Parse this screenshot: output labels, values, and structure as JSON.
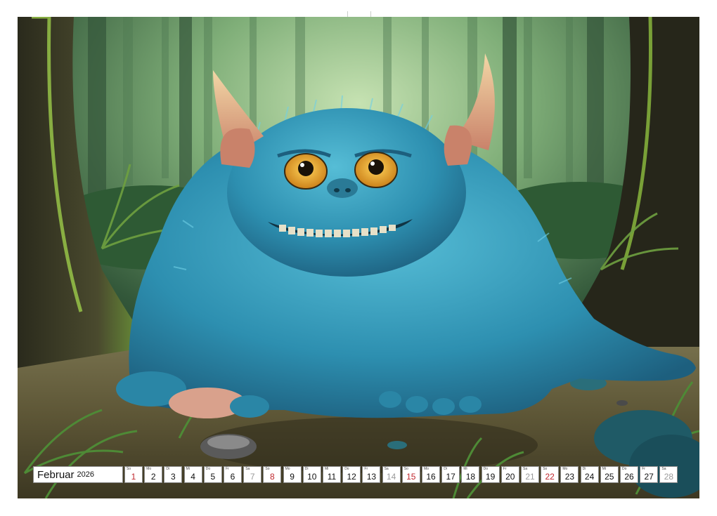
{
  "calendar": {
    "month": "Februar",
    "year": "2026",
    "days": [
      {
        "wd": "So",
        "num": "1",
        "type": "sun"
      },
      {
        "wd": "Mo",
        "num": "2",
        "type": "week"
      },
      {
        "wd": "Di",
        "num": "3",
        "type": "week"
      },
      {
        "wd": "Mi",
        "num": "4",
        "type": "week"
      },
      {
        "wd": "Do",
        "num": "5",
        "type": "week"
      },
      {
        "wd": "Fr",
        "num": "6",
        "type": "week"
      },
      {
        "wd": "Sa",
        "num": "7",
        "type": "sat"
      },
      {
        "wd": "So",
        "num": "8",
        "type": "sun"
      },
      {
        "wd": "Mo",
        "num": "9",
        "type": "week"
      },
      {
        "wd": "Di",
        "num": "10",
        "type": "week"
      },
      {
        "wd": "Mi",
        "num": "11",
        "type": "week"
      },
      {
        "wd": "Do",
        "num": "12",
        "type": "week"
      },
      {
        "wd": "Fr",
        "num": "13",
        "type": "week"
      },
      {
        "wd": "Sa",
        "num": "14",
        "type": "sat"
      },
      {
        "wd": "So",
        "num": "15",
        "type": "sun"
      },
      {
        "wd": "Mo",
        "num": "16",
        "type": "week"
      },
      {
        "wd": "Di",
        "num": "17",
        "type": "week"
      },
      {
        "wd": "Mi",
        "num": "18",
        "type": "week"
      },
      {
        "wd": "Do",
        "num": "19",
        "type": "week"
      },
      {
        "wd": "Fr",
        "num": "20",
        "type": "week"
      },
      {
        "wd": "Sa",
        "num": "21",
        "type": "sat"
      },
      {
        "wd": "So",
        "num": "22",
        "type": "sun"
      },
      {
        "wd": "Mo",
        "num": "23",
        "type": "week"
      },
      {
        "wd": "Di",
        "num": "24",
        "type": "week"
      },
      {
        "wd": "Mi",
        "num": "25",
        "type": "week"
      },
      {
        "wd": "Do",
        "num": "26",
        "type": "week"
      },
      {
        "wd": "Fr",
        "num": "27",
        "type": "week"
      },
      {
        "wd": "Sa",
        "num": "28",
        "type": "sat"
      }
    ]
  },
  "colors": {
    "fur": "#2f95b4",
    "fur_light": "#5cc3dc",
    "forest_dark": "#1d3a26",
    "forest_mist": "#b8d6a6",
    "ground": "#6e6440",
    "eye": "#e9a62a",
    "sunday_red": "#c0272d",
    "saturday_gray": "#9a9a9a"
  },
  "icons": [
    "spiral-binding-icon",
    "hanger-notch-icon"
  ]
}
